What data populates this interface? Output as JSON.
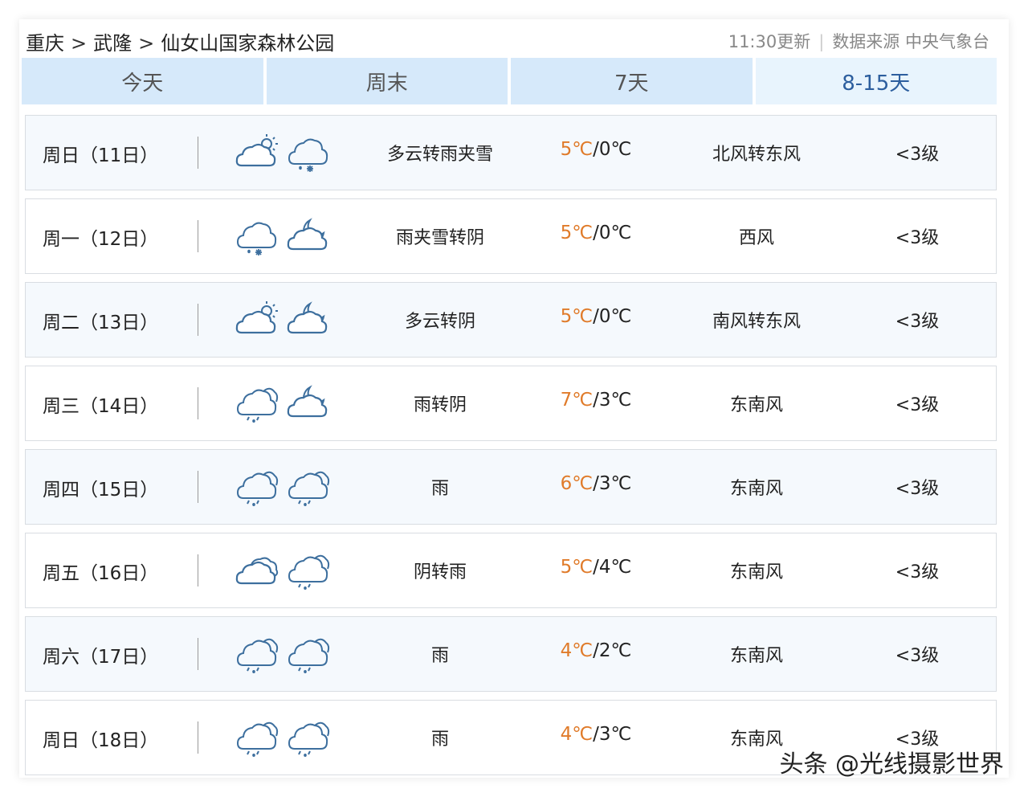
{
  "breadcrumb": [
    "重庆",
    "武隆",
    "仙女山国家森林公园"
  ],
  "breadcrumb_separator": ">",
  "update_time": "11:30更新",
  "source_label": "数据来源 中央气象台",
  "tabs": [
    {
      "label": "今天",
      "active": false
    },
    {
      "label": "周末",
      "active": false
    },
    {
      "label": "7天",
      "active": false
    },
    {
      "label": "8-15天",
      "active": true
    }
  ],
  "forecast": [
    {
      "day": "周日（11日）",
      "icons": [
        "partly-cloudy-day-icon",
        "sleet-icon"
      ],
      "desc": "多云转雨夹雪",
      "high": "5℃",
      "low": "0℃",
      "wind": "北风转东风",
      "level": "<3级"
    },
    {
      "day": "周一（12日）",
      "icons": [
        "sleet-icon",
        "cloudy-night-icon"
      ],
      "desc": "雨夹雪转阴",
      "high": "5℃",
      "low": "0℃",
      "wind": "西风",
      "level": "<3级"
    },
    {
      "day": "周二（13日）",
      "icons": [
        "partly-cloudy-day-icon",
        "cloudy-night-icon"
      ],
      "desc": "多云转阴",
      "high": "5℃",
      "low": "0℃",
      "wind": "南风转东风",
      "level": "<3级"
    },
    {
      "day": "周三（14日）",
      "icons": [
        "rain-icon",
        "cloudy-night-icon"
      ],
      "desc": "雨转阴",
      "high": "7℃",
      "low": "3℃",
      "wind": "东南风",
      "level": "<3级"
    },
    {
      "day": "周四（15日）",
      "icons": [
        "rain-icon",
        "rain-icon"
      ],
      "desc": "雨",
      "high": "6℃",
      "low": "3℃",
      "wind": "东南风",
      "level": "<3级"
    },
    {
      "day": "周五（16日）",
      "icons": [
        "overcast-icon",
        "rain-icon"
      ],
      "desc": "阴转雨",
      "high": "5℃",
      "low": "4℃",
      "wind": "东南风",
      "level": "<3级"
    },
    {
      "day": "周六（17日）",
      "icons": [
        "rain-icon",
        "rain-icon"
      ],
      "desc": "雨",
      "high": "4℃",
      "low": "2℃",
      "wind": "东南风",
      "level": "<3级"
    },
    {
      "day": "周日（18日）",
      "icons": [
        "rain-icon",
        "rain-icon"
      ],
      "desc": "雨",
      "high": "4℃",
      "low": "3℃",
      "wind": "东南风",
      "level": "<3级"
    }
  ],
  "watermark": "头条 @光线摄影世界",
  "colors": {
    "high_temp": "#e07b2a",
    "tab_bg": "#d6e9fa",
    "tab_active_bg": "#e8f4fd",
    "tab_active_text": "#2c5e9e",
    "icon_stroke": "#3d6f9e"
  }
}
